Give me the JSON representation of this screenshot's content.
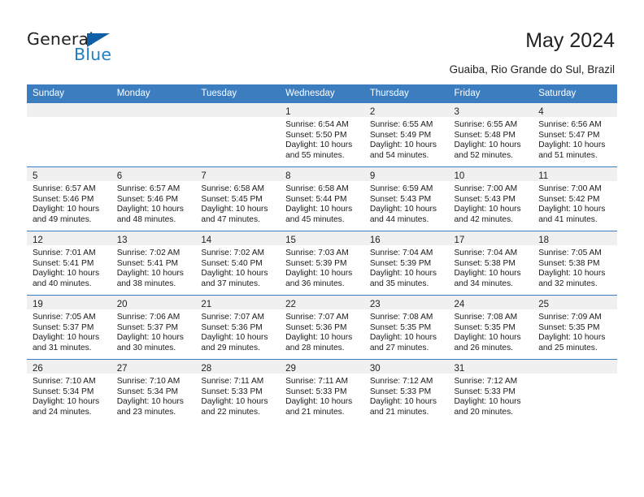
{
  "brand": {
    "name_top": "General",
    "name_bottom": "Blue",
    "accent_color": "#1f7fc4",
    "triangle_color": "#0f5fa6"
  },
  "header": {
    "title": "May 2024",
    "subtitle": "Guaiba, Rio Grande do Sul, Brazil"
  },
  "theme": {
    "header_row_bg": "#3b7dbf",
    "header_row_text": "#ffffff",
    "daynum_band_bg": "#f0f0f0",
    "row_divider": "#3b7dbf"
  },
  "weekdays": [
    "Sunday",
    "Monday",
    "Tuesday",
    "Wednesday",
    "Thursday",
    "Friday",
    "Saturday"
  ],
  "weeks": [
    [
      {
        "day": "",
        "lines": []
      },
      {
        "day": "",
        "lines": []
      },
      {
        "day": "",
        "lines": []
      },
      {
        "day": "1",
        "lines": [
          "Sunrise: 6:54 AM",
          "Sunset: 5:50 PM",
          "Daylight: 10 hours",
          "and 55 minutes."
        ]
      },
      {
        "day": "2",
        "lines": [
          "Sunrise: 6:55 AM",
          "Sunset: 5:49 PM",
          "Daylight: 10 hours",
          "and 54 minutes."
        ]
      },
      {
        "day": "3",
        "lines": [
          "Sunrise: 6:55 AM",
          "Sunset: 5:48 PM",
          "Daylight: 10 hours",
          "and 52 minutes."
        ]
      },
      {
        "day": "4",
        "lines": [
          "Sunrise: 6:56 AM",
          "Sunset: 5:47 PM",
          "Daylight: 10 hours",
          "and 51 minutes."
        ]
      }
    ],
    [
      {
        "day": "5",
        "lines": [
          "Sunrise: 6:57 AM",
          "Sunset: 5:46 PM",
          "Daylight: 10 hours",
          "and 49 minutes."
        ]
      },
      {
        "day": "6",
        "lines": [
          "Sunrise: 6:57 AM",
          "Sunset: 5:46 PM",
          "Daylight: 10 hours",
          "and 48 minutes."
        ]
      },
      {
        "day": "7",
        "lines": [
          "Sunrise: 6:58 AM",
          "Sunset: 5:45 PM",
          "Daylight: 10 hours",
          "and 47 minutes."
        ]
      },
      {
        "day": "8",
        "lines": [
          "Sunrise: 6:58 AM",
          "Sunset: 5:44 PM",
          "Daylight: 10 hours",
          "and 45 minutes."
        ]
      },
      {
        "day": "9",
        "lines": [
          "Sunrise: 6:59 AM",
          "Sunset: 5:43 PM",
          "Daylight: 10 hours",
          "and 44 minutes."
        ]
      },
      {
        "day": "10",
        "lines": [
          "Sunrise: 7:00 AM",
          "Sunset: 5:43 PM",
          "Daylight: 10 hours",
          "and 42 minutes."
        ]
      },
      {
        "day": "11",
        "lines": [
          "Sunrise: 7:00 AM",
          "Sunset: 5:42 PM",
          "Daylight: 10 hours",
          "and 41 minutes."
        ]
      }
    ],
    [
      {
        "day": "12",
        "lines": [
          "Sunrise: 7:01 AM",
          "Sunset: 5:41 PM",
          "Daylight: 10 hours",
          "and 40 minutes."
        ]
      },
      {
        "day": "13",
        "lines": [
          "Sunrise: 7:02 AM",
          "Sunset: 5:41 PM",
          "Daylight: 10 hours",
          "and 38 minutes."
        ]
      },
      {
        "day": "14",
        "lines": [
          "Sunrise: 7:02 AM",
          "Sunset: 5:40 PM",
          "Daylight: 10 hours",
          "and 37 minutes."
        ]
      },
      {
        "day": "15",
        "lines": [
          "Sunrise: 7:03 AM",
          "Sunset: 5:39 PM",
          "Daylight: 10 hours",
          "and 36 minutes."
        ]
      },
      {
        "day": "16",
        "lines": [
          "Sunrise: 7:04 AM",
          "Sunset: 5:39 PM",
          "Daylight: 10 hours",
          "and 35 minutes."
        ]
      },
      {
        "day": "17",
        "lines": [
          "Sunrise: 7:04 AM",
          "Sunset: 5:38 PM",
          "Daylight: 10 hours",
          "and 34 minutes."
        ]
      },
      {
        "day": "18",
        "lines": [
          "Sunrise: 7:05 AM",
          "Sunset: 5:38 PM",
          "Daylight: 10 hours",
          "and 32 minutes."
        ]
      }
    ],
    [
      {
        "day": "19",
        "lines": [
          "Sunrise: 7:05 AM",
          "Sunset: 5:37 PM",
          "Daylight: 10 hours",
          "and 31 minutes."
        ]
      },
      {
        "day": "20",
        "lines": [
          "Sunrise: 7:06 AM",
          "Sunset: 5:37 PM",
          "Daylight: 10 hours",
          "and 30 minutes."
        ]
      },
      {
        "day": "21",
        "lines": [
          "Sunrise: 7:07 AM",
          "Sunset: 5:36 PM",
          "Daylight: 10 hours",
          "and 29 minutes."
        ]
      },
      {
        "day": "22",
        "lines": [
          "Sunrise: 7:07 AM",
          "Sunset: 5:36 PM",
          "Daylight: 10 hours",
          "and 28 minutes."
        ]
      },
      {
        "day": "23",
        "lines": [
          "Sunrise: 7:08 AM",
          "Sunset: 5:35 PM",
          "Daylight: 10 hours",
          "and 27 minutes."
        ]
      },
      {
        "day": "24",
        "lines": [
          "Sunrise: 7:08 AM",
          "Sunset: 5:35 PM",
          "Daylight: 10 hours",
          "and 26 minutes."
        ]
      },
      {
        "day": "25",
        "lines": [
          "Sunrise: 7:09 AM",
          "Sunset: 5:35 PM",
          "Daylight: 10 hours",
          "and 25 minutes."
        ]
      }
    ],
    [
      {
        "day": "26",
        "lines": [
          "Sunrise: 7:10 AM",
          "Sunset: 5:34 PM",
          "Daylight: 10 hours",
          "and 24 minutes."
        ]
      },
      {
        "day": "27",
        "lines": [
          "Sunrise: 7:10 AM",
          "Sunset: 5:34 PM",
          "Daylight: 10 hours",
          "and 23 minutes."
        ]
      },
      {
        "day": "28",
        "lines": [
          "Sunrise: 7:11 AM",
          "Sunset: 5:33 PM",
          "Daylight: 10 hours",
          "and 22 minutes."
        ]
      },
      {
        "day": "29",
        "lines": [
          "Sunrise: 7:11 AM",
          "Sunset: 5:33 PM",
          "Daylight: 10 hours",
          "and 21 minutes."
        ]
      },
      {
        "day": "30",
        "lines": [
          "Sunrise: 7:12 AM",
          "Sunset: 5:33 PM",
          "Daylight: 10 hours",
          "and 21 minutes."
        ]
      },
      {
        "day": "31",
        "lines": [
          "Sunrise: 7:12 AM",
          "Sunset: 5:33 PM",
          "Daylight: 10 hours",
          "and 20 minutes."
        ]
      },
      {
        "day": "",
        "lines": []
      }
    ]
  ]
}
